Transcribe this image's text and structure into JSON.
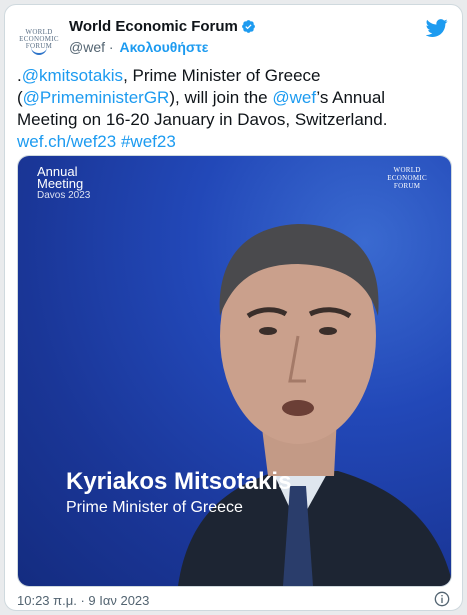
{
  "header": {
    "logo_lines": [
      "WORLD",
      "ECONOMIC",
      "FORUM"
    ],
    "display_name": "World Economic Forum",
    "handle": "@wef",
    "separator": "·",
    "follow_label": "Ακολουθήστε"
  },
  "tweet": {
    "parts": [
      {
        "text": ".",
        "link": false
      },
      {
        "text": "@kmitsotakis",
        "link": true
      },
      {
        "text": ", Prime Minister of Greece (",
        "link": false
      },
      {
        "text": "@PrimeministerGR",
        "link": true
      },
      {
        "text": "), will join the ",
        "link": false
      },
      {
        "text": "@wef",
        "link": true
      },
      {
        "text": "’s Annual Meeting on 16-20 January in Davos, Switzerland. ",
        "link": false
      },
      {
        "text": "wef.ch/wef23",
        "link": true
      },
      {
        "text": " ",
        "link": false
      },
      {
        "text": "#wef23",
        "link": true
      }
    ]
  },
  "media": {
    "badge_title_1": "Annual",
    "badge_title_2": "Meeting",
    "badge_sub": "Davos 2023",
    "logo_lines": [
      "WORLD",
      "ECONOMIC",
      "FORUM"
    ],
    "caption_name": "Kyriakos Mitsotakis",
    "caption_role": "Prime Minister of Greece"
  },
  "footer": {
    "timestamp": "10:23 π.μ. · 9 Ιαν 2023"
  },
  "colors": {
    "link": "#1d9bf0",
    "text": "#0f1419",
    "muted": "#536471"
  }
}
